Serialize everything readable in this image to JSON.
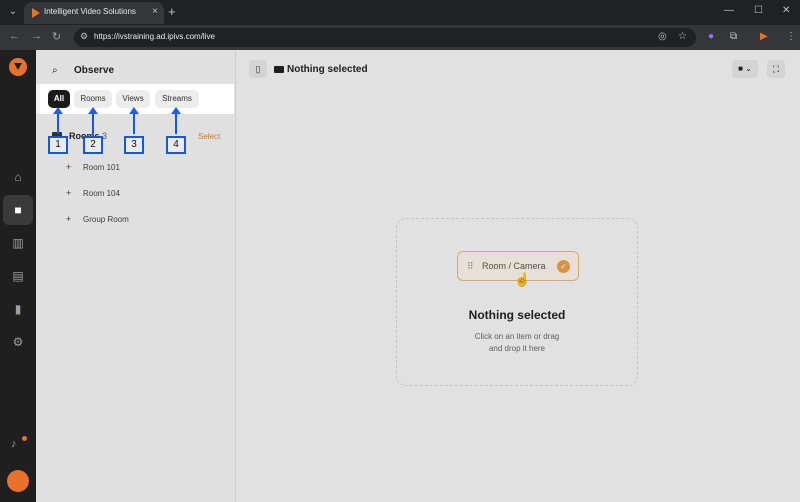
{
  "browser": {
    "tab_title": "Intelligent Video Solutions",
    "url": "https://ivstraining.ad.ipivs.com/live",
    "tab_close": "×",
    "new_tab": "+"
  },
  "sidebar": {
    "title": "Observe",
    "filters": [
      "All",
      "Rooms",
      "Views",
      "Streams"
    ],
    "active_filter": "All",
    "tree": {
      "head_label": "Rooms",
      "head_count": "3",
      "select": "Select",
      "items": [
        "Room 101",
        "Room 104",
        "Group Room"
      ]
    }
  },
  "callouts": [
    "1",
    "2",
    "3",
    "4"
  ],
  "main": {
    "title": "Nothing selected",
    "chip_label": "Room / Camera",
    "empty_title": "Nothing selected",
    "empty_sub1": "Click on an item or drag",
    "empty_sub2": "and drop it here"
  },
  "colors": {
    "accent": "#e8712b",
    "callout": "#1a5ff0",
    "active_chip": "#1a1a1a"
  }
}
